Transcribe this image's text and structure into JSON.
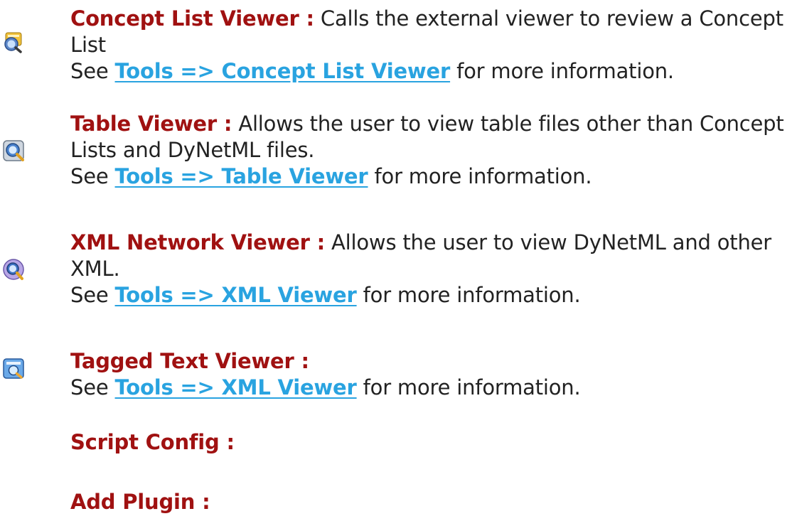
{
  "entries": [
    {
      "icon": "concept-list-viewer-icon",
      "term": "Concept List Viewer :",
      "description": "Calls the external viewer to review a Concept List",
      "see_prefix": "See",
      "link": "Tools => Concept List Viewer",
      "see_suffix": "for more information."
    },
    {
      "icon": "table-viewer-icon",
      "term": "Table Viewer :",
      "description": "Allows the user to view table files other than Concept Lists and DyNetML files.",
      "see_prefix": "See",
      "link": "Tools => Table Viewer",
      "see_suffix": "for more information."
    },
    {
      "icon": "xml-network-viewer-icon",
      "term": "XML Network Viewer :",
      "description": "Allows the user to view DyNetML and other XML.",
      "see_prefix": "See",
      "link": "Tools => XML Viewer",
      "see_suffix": "for more information."
    },
    {
      "icon": "tagged-text-viewer-icon",
      "term": "Tagged Text Viewer :",
      "see_prefix": "See",
      "link": "Tools => XML Viewer",
      "see_suffix": "for more information."
    },
    {
      "term": "Script Config :"
    },
    {
      "term": "Add Plugin :"
    }
  ],
  "colors": {
    "term": "#a01111",
    "link": "#29a3e0",
    "text": "#222222"
  }
}
